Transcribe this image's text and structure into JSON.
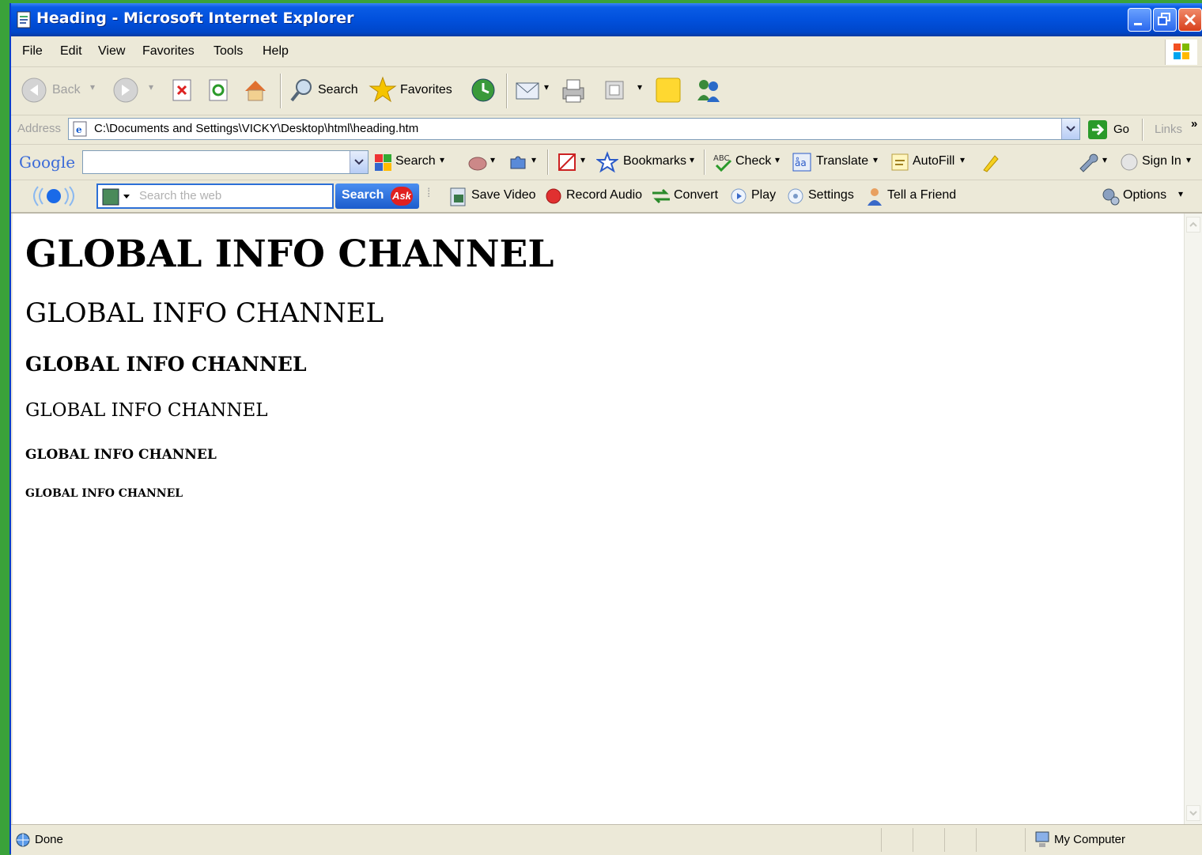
{
  "window": {
    "title": "Heading - Microsoft Internet Explorer"
  },
  "menubar": [
    "File",
    "Edit",
    "View",
    "Favorites",
    "Tools",
    "Help"
  ],
  "std_toolbar": {
    "back": "Back",
    "search": "Search",
    "favorites": "Favorites"
  },
  "address_bar": {
    "label": "Address",
    "url": "C:\\Documents and Settings\\VICKY\\Desktop\\html\\heading.htm",
    "go": "Go",
    "links": "Links",
    "more": "»"
  },
  "google_toolbar": {
    "logo": "Google",
    "search": "Search",
    "bookmarks": "Bookmarks",
    "check": "Check",
    "translate": "Translate",
    "autofill": "AutoFill",
    "sign_in": "Sign In"
  },
  "ask_toolbar": {
    "search_placeholder": "Search the web",
    "search_button": "Search",
    "ask_logo": "Ask",
    "save_video": "Save Video",
    "record_audio": "Record Audio",
    "convert": "Convert",
    "play": "Play",
    "settings": "Settings",
    "tell_friend": "Tell a Friend",
    "options": "Options"
  },
  "page": {
    "h1": "GLOBAL INFO CHANNEL",
    "h2": "GLOBAL INFO CHANNEL",
    "h3": "GLOBAL INFO CHANNEL",
    "h4": "GLOBAL INFO CHANNEL",
    "h5": "GLOBAL INFO CHANNEL",
    "h6": "GLOBAL INFO CHANNEL"
  },
  "statusbar": {
    "status": "Done",
    "zone": "My Computer"
  },
  "colors": {
    "titlebar": "#0150dc",
    "chrome": "#ece9d8",
    "desktop": "#3aa23a"
  }
}
